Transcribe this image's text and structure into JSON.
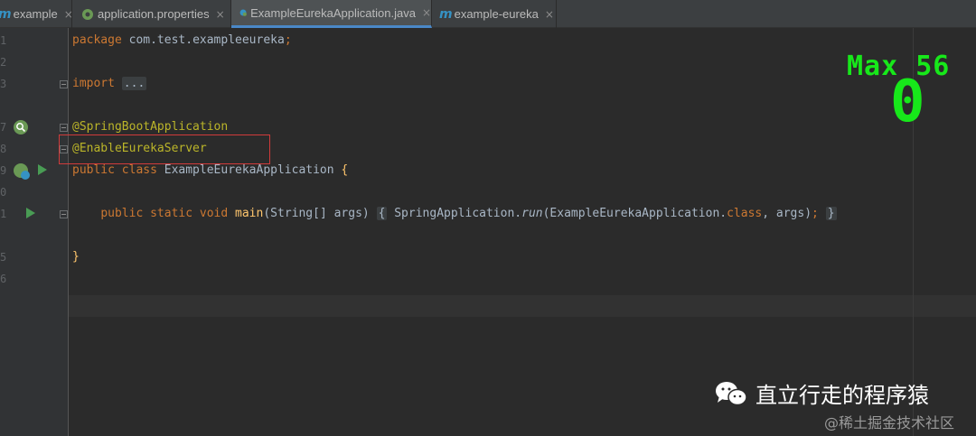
{
  "tabs": [
    {
      "label": "example",
      "icon": "maven-m-icon",
      "active": false
    },
    {
      "label": "application.properties",
      "icon": "spring-config-icon",
      "active": false
    },
    {
      "label": "ExampleEurekaApplication.java",
      "icon": "spring-class-icon",
      "active": true
    },
    {
      "label": "example-eureka",
      "icon": "maven-m-icon",
      "active": false
    }
  ],
  "tab_m_glyph": "m",
  "close_glyph": "×",
  "line_numbers": [
    "1",
    "2",
    "3",
    "",
    "7",
    "8",
    "9",
    "0",
    "1",
    "",
    "5",
    "6"
  ],
  "code": {
    "package_kw": "package",
    "package_name": " com.test.exampleeureka",
    "semicolon": ";",
    "import_kw": "import",
    "import_fold": "...",
    "ann_springboot": "@SpringBootApplication",
    "ann_eureka": "@EnableEurekaServer",
    "class_kw": "public class",
    "class_name": " ExampleEurekaApplication ",
    "class_brace": "{",
    "main_kw": "public static void",
    "main_name": "main",
    "main_params": "(String[] args) ",
    "main_open": "{",
    "main_body_1": " SpringApplication.",
    "main_run": "run",
    "main_body_2": "(ExampleEurekaApplication.",
    "main_class_kw": "class",
    "main_body_3": ", args)",
    "main_semicolon": ";",
    "main_close": "}",
    "closing_brace": "}"
  },
  "overlay": {
    "label": "Max 56",
    "value": "0"
  },
  "watermark": {
    "title": "直立行走的程序猿",
    "source": "@稀土掘金技术社区"
  },
  "colors": {
    "accent_tab": "#4a88c7",
    "overlay_green": "#17e81a",
    "highlight_box": "#d13b3b"
  }
}
